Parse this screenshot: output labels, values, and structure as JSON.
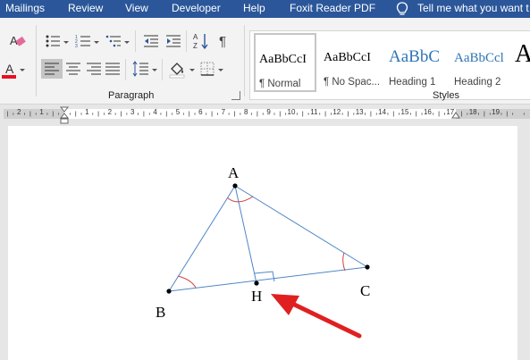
{
  "ribbon_tabs": [
    "Mailings",
    "Review",
    "View",
    "Developer",
    "Help",
    "Foxit Reader PDF"
  ],
  "tell_me": {
    "text": "Tell me what you want t",
    "icon": "lightbulb-icon"
  },
  "paragraph_group": {
    "label": "Paragraph"
  },
  "styles_group": {
    "label": "Styles",
    "items": [
      {
        "sample": "AaBbCcI",
        "name": "¶ Normal",
        "selected": true
      },
      {
        "sample": "AaBbCcI",
        "name": "¶ No Spac..."
      },
      {
        "sample": "AaBbC",
        "name": "Heading 1"
      },
      {
        "sample": "AaBbCcl",
        "name": "Heading 2"
      },
      {
        "sample": "A",
        "name": ""
      }
    ]
  },
  "ruler": {
    "numbers": [
      "2",
      "1",
      "1",
      "2",
      "3",
      "4",
      "5",
      "6",
      "7",
      "8",
      "9",
      "10",
      "11",
      "12",
      "13",
      "14",
      "15",
      "16",
      "17",
      "18",
      "19"
    ]
  },
  "diagram": {
    "labels": {
      "a": "A",
      "b": "B",
      "c": "C",
      "h": "H"
    },
    "colors": {
      "lines": "#4f86c6",
      "angles": "#d04040",
      "arrow": "#e02020"
    }
  },
  "colors": {
    "tab_bar": "#2b579a",
    "ribbon": "#f3f3f3",
    "font_color_bar": "#e81123",
    "heading_blue": "#2e74b5"
  }
}
